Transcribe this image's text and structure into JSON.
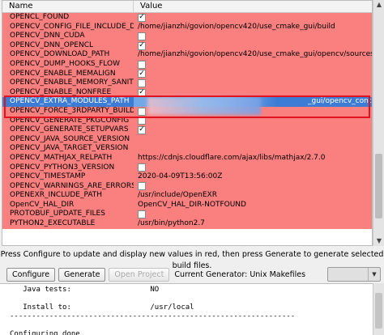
{
  "table": {
    "headers": {
      "name": "Name",
      "value": "Value"
    },
    "rows": [
      {
        "name": "OPENCL_FOUND",
        "value": "",
        "checkbox": true,
        "checked": true
      },
      {
        "name": "OPENCV_CONFIG_FILE_INCLUDE_DIR",
        "value": "/home/jianzhi/govion/opencv420/use_cmake_gui/build",
        "checkbox": false
      },
      {
        "name": "OPENCV_DNN_CUDA",
        "value": "",
        "checkbox": true,
        "checked": false
      },
      {
        "name": "OPENCV_DNN_OPENCL",
        "value": "",
        "checkbox": true,
        "checked": true
      },
      {
        "name": "OPENCV_DOWNLOAD_PATH",
        "value": "/home/jianzhi/govion/opencv420/use_cmake_gui/opencv/sources/.cac·",
        "checkbox": false
      },
      {
        "name": "OPENCV_DUMP_HOOKS_FLOW",
        "value": "",
        "checkbox": true,
        "checked": false
      },
      {
        "name": "OPENCV_ENABLE_MEMALIGN",
        "value": "",
        "checkbox": true,
        "checked": true
      },
      {
        "name": "OPENCV_ENABLE_MEMORY_SANITI···",
        "value": "",
        "checkbox": true,
        "checked": false
      },
      {
        "name": "OPENCV_ENABLE_NONFREE",
        "value": "",
        "checkbox": true,
        "checked": true
      },
      {
        "name": "OPENCV_EXTRA_MODULES_PATH",
        "value": "_gui/opencv_contrib-4.2.",
        "checkbox": false,
        "selected": true
      },
      {
        "name": "OPENCV_FORCE_3RDPARTY_BUILD",
        "value": "",
        "checkbox": true,
        "checked": false
      },
      {
        "name": "OPENCV_GENERATE_PKGCONFIG",
        "value": "",
        "checkbox": true,
        "checked": false
      },
      {
        "name": "OPENCV_GENERATE_SETUPVARS",
        "value": "",
        "checkbox": true,
        "checked": true
      },
      {
        "name": "OPENCV_JAVA_SOURCE_VERSION",
        "value": "",
        "checkbox": false
      },
      {
        "name": "OPENCV_JAVA_TARGET_VERSION",
        "value": "",
        "checkbox": false
      },
      {
        "name": "OPENCV_MATHJAX_RELPATH",
        "value": "https://cdnjs.cloudflare.com/ajax/libs/mathjax/2.7.0",
        "checkbox": false
      },
      {
        "name": "OPENCV_PYTHON3_VERSION",
        "value": "",
        "checkbox": true,
        "checked": false
      },
      {
        "name": "OPENCV_TIMESTAMP",
        "value": "2020-04-09T13:56:00Z",
        "checkbox": false
      },
      {
        "name": "OPENCV_WARNINGS_ARE_ERRORS",
        "value": "",
        "checkbox": true,
        "checked": false
      },
      {
        "name": "OPENEXR_INCLUDE_PATH",
        "value": "/usr/include/OpenEXR",
        "checkbox": false
      },
      {
        "name": "OpenCV_HAL_DIR",
        "value": "OpenCV_HAL_DIR-NOTFOUND",
        "checkbox": false
      },
      {
        "name": "PROTOBUF_UPDATE_FILES",
        "value": "",
        "checkbox": true,
        "checked": false
      },
      {
        "name": "PYTHON2_EXECUTABLE",
        "value": "/usr/bin/python2.7",
        "checkbox": false
      }
    ]
  },
  "check_glyph": "✓",
  "scroll": {
    "up": "▲",
    "down": "▼"
  },
  "hint": "Press Configure to update and display new values in red, then press Generate to generate selected build files.",
  "toolbar": {
    "configure": "Configure",
    "generate": "Generate",
    "open_project": "Open Project",
    "current_generator": "Current Generator: Unix Makefiles"
  },
  "output_lines": [
    "   Java tests:                  NO",
    "",
    "   Install to:                  /usr/local",
    "-----------------------------------------------------------------",
    "",
    "Configuring done"
  ],
  "colors": {
    "changed_row": "#fa7f7f",
    "selected_row": "#3d7cd4",
    "highlight_box": "#e0141e"
  }
}
